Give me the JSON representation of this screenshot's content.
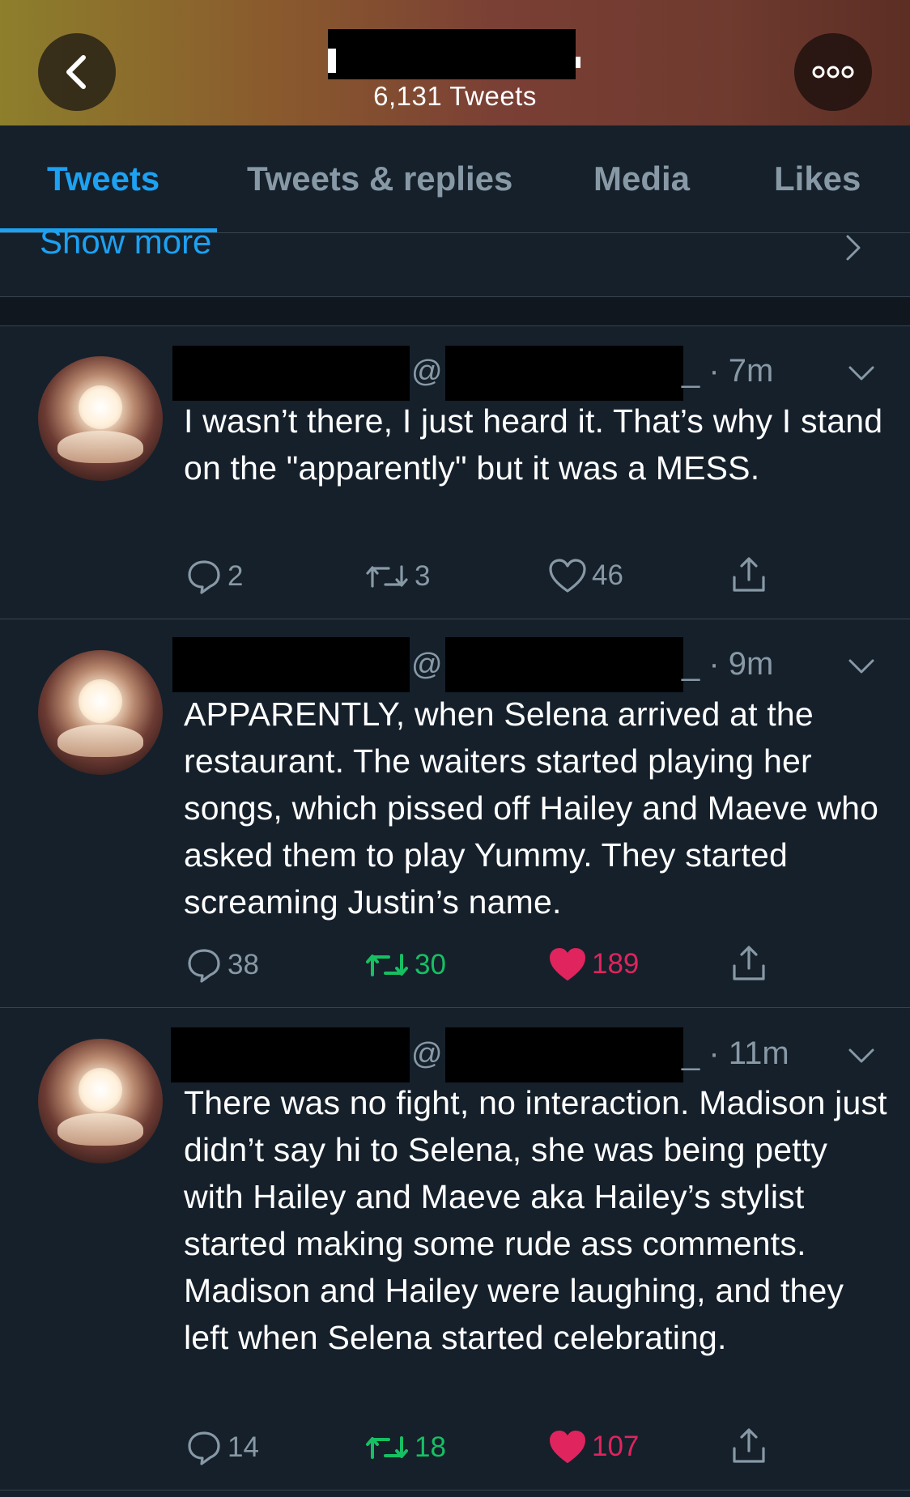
{
  "header": {
    "tweet_count": "6,131 Tweets"
  },
  "tabs": [
    {
      "label": "Tweets",
      "active": true
    },
    {
      "label": "Tweets & replies",
      "active": false
    },
    {
      "label": "Media",
      "active": false
    },
    {
      "label": "Likes",
      "active": false
    }
  ],
  "show_more": {
    "label": "Show more"
  },
  "tweets": [
    {
      "at": "@",
      "time": "_ · 7m",
      "text": "I wasn’t there, I just heard it. That’s why I stand on the \"apparently\" but it was a MESS.",
      "replies": "2",
      "retweets": "3",
      "likes": "46",
      "liked": false,
      "retweeted": false
    },
    {
      "at": "@",
      "time": "_ · 9m",
      "text": "APPARENTLY, when Selena arrived at the restaurant. The waiters started playing her songs, which pissed off Hailey and Maeve who asked them to play Yummy. They started screaming Justin’s name.",
      "replies": "38",
      "retweets": "30",
      "likes": "189",
      "liked": true,
      "retweeted": true
    },
    {
      "at": "@",
      "time": "_ · 11m",
      "text": "There was no fight, no interaction. Madison just didn’t say hi to Selena, she was being petty with Hailey and Maeve aka Hailey’s stylist started making some rude ass comments. Madison and Hailey were laughing, and they left when Selena started celebrating.",
      "replies": "14",
      "retweets": "18",
      "likes": "107",
      "liked": true,
      "retweeted": true
    }
  ],
  "colors": {
    "background": "#15202b",
    "accent": "#1da1f2",
    "muted": "#8899a6",
    "retweet_active": "#17bf63",
    "like_active": "#e0245e"
  },
  "icons": [
    "back-arrow-icon",
    "more-options-icon",
    "chevron-right-icon",
    "chevron-down-icon",
    "reply-icon",
    "retweet-icon",
    "like-icon",
    "share-icon"
  ]
}
